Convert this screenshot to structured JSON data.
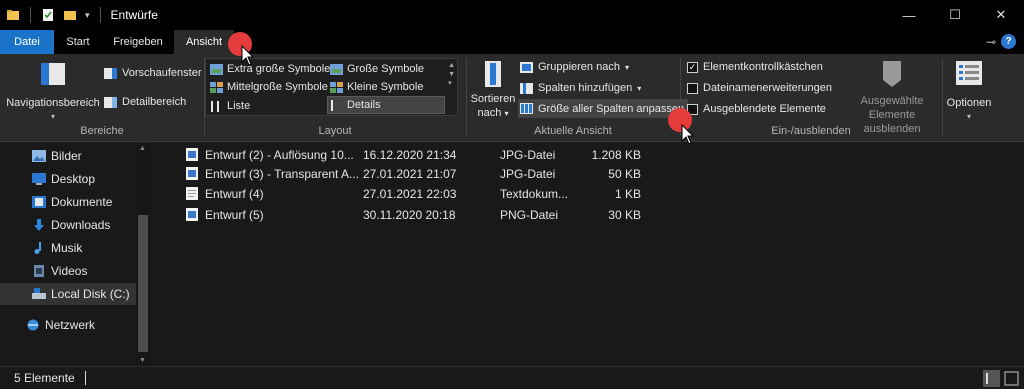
{
  "window": {
    "title": "Entwürfe",
    "controls": [
      "—",
      "☐",
      "✕"
    ]
  },
  "tabs": [
    {
      "label": "Datei"
    },
    {
      "label": "Start"
    },
    {
      "label": "Freigeben"
    },
    {
      "label": "Ansicht"
    }
  ],
  "ribbon": {
    "bereiche": {
      "label": "Bereiche",
      "navigationsbereich": "Navigationsbereich",
      "vorschaufenster": "Vorschaufenster",
      "detailbereich": "Detailbereich"
    },
    "layout": {
      "label": "Layout",
      "items": [
        "Extra große Symbole",
        "Große Symbole",
        "Mittelgroße Symbole",
        "Kleine Symbole",
        "Liste",
        "Details"
      ]
    },
    "aktuelle_ansicht": {
      "label": "Aktuelle Ansicht",
      "sortieren": "Sortieren",
      "nach": "nach",
      "gruppieren": "Gruppieren nach",
      "spalten": "Spalten hinzufügen",
      "groesse": "Größe aller Spalten anpassen"
    },
    "einausblenden": {
      "label": "Ein-/ausblenden",
      "checkboxes": [
        {
          "label": "Elementkontrollkästchen",
          "checked": true
        },
        {
          "label": "Dateinamenerweiterungen",
          "checked": false
        },
        {
          "label": "Ausgeblendete Elemente",
          "checked": false
        }
      ],
      "ausgewaehlte_1": "Ausgewählte",
      "ausgewaehlte_2": "Elemente ausblenden"
    },
    "optionen": "Optionen"
  },
  "sidebar": {
    "items": [
      {
        "label": "Bilder",
        "icon": "pictures-icon"
      },
      {
        "label": "Desktop",
        "icon": "desktop-icon"
      },
      {
        "label": "Dokumente",
        "icon": "documents-icon"
      },
      {
        "label": "Downloads",
        "icon": "downloads-icon"
      },
      {
        "label": "Musik",
        "icon": "music-icon"
      },
      {
        "label": "Videos",
        "icon": "videos-icon"
      },
      {
        "label": "Local Disk (C:)",
        "icon": "disk-icon"
      },
      {
        "label": "Netzwerk",
        "icon": "network-icon"
      }
    ]
  },
  "files": [
    {
      "name": "Entwurf (2) - Auflösung 10...",
      "date": "16.12.2020 21:34",
      "type": "JPG-Datei",
      "size": "1.208 KB",
      "icon": "image-file-icon"
    },
    {
      "name": "Entwurf (3) - Transparent A...",
      "date": "27.01.2021 21:07",
      "type": "JPG-Datei",
      "size": "50 KB",
      "icon": "image-file-icon"
    },
    {
      "name": "Entwurf (4)",
      "date": "27.01.2021 22:03",
      "type": "Textdokum...",
      "size": "1 KB",
      "icon": "text-file-icon"
    },
    {
      "name": "Entwurf (5)",
      "date": "30.11.2020 20:18",
      "type": "PNG-Datei",
      "size": "30 KB",
      "icon": "image-file-icon"
    }
  ],
  "status": {
    "count": "5 Elemente"
  },
  "colors": {
    "accent": "#1a73c9",
    "marker": "#e63b3b",
    "folder": "#f2c24f"
  }
}
